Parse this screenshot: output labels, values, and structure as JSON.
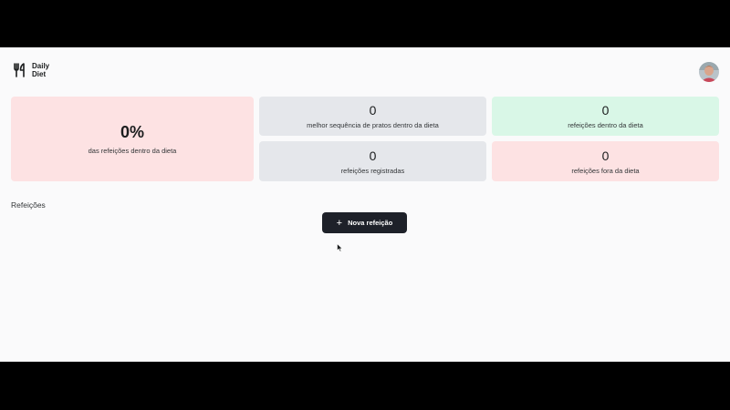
{
  "header": {
    "logo_line1": "Daily",
    "logo_line2": "Diet",
    "logo_icon": "fork-knife-icon",
    "avatar_icon": "user-avatar"
  },
  "stats": {
    "percent_value": "0%",
    "percent_caption": "das refeições dentro da dieta",
    "best_sequence_value": "0",
    "best_sequence_caption": "melhor sequência de pratos dentro da dieta",
    "registered_value": "0",
    "registered_caption": "refeições registradas",
    "inside_value": "0",
    "inside_caption": "refeições dentro da dieta",
    "outside_value": "0",
    "outside_caption": "refeições fora da dieta"
  },
  "meals": {
    "section_title": "Refeições",
    "new_button_label": "Nova refeição",
    "new_button_icon": "plus-icon"
  },
  "colors": {
    "red_card": "#fde2e3",
    "gray_card": "#e5e7eb",
    "green_card": "#d9f7e7",
    "button": "#1e2129"
  }
}
